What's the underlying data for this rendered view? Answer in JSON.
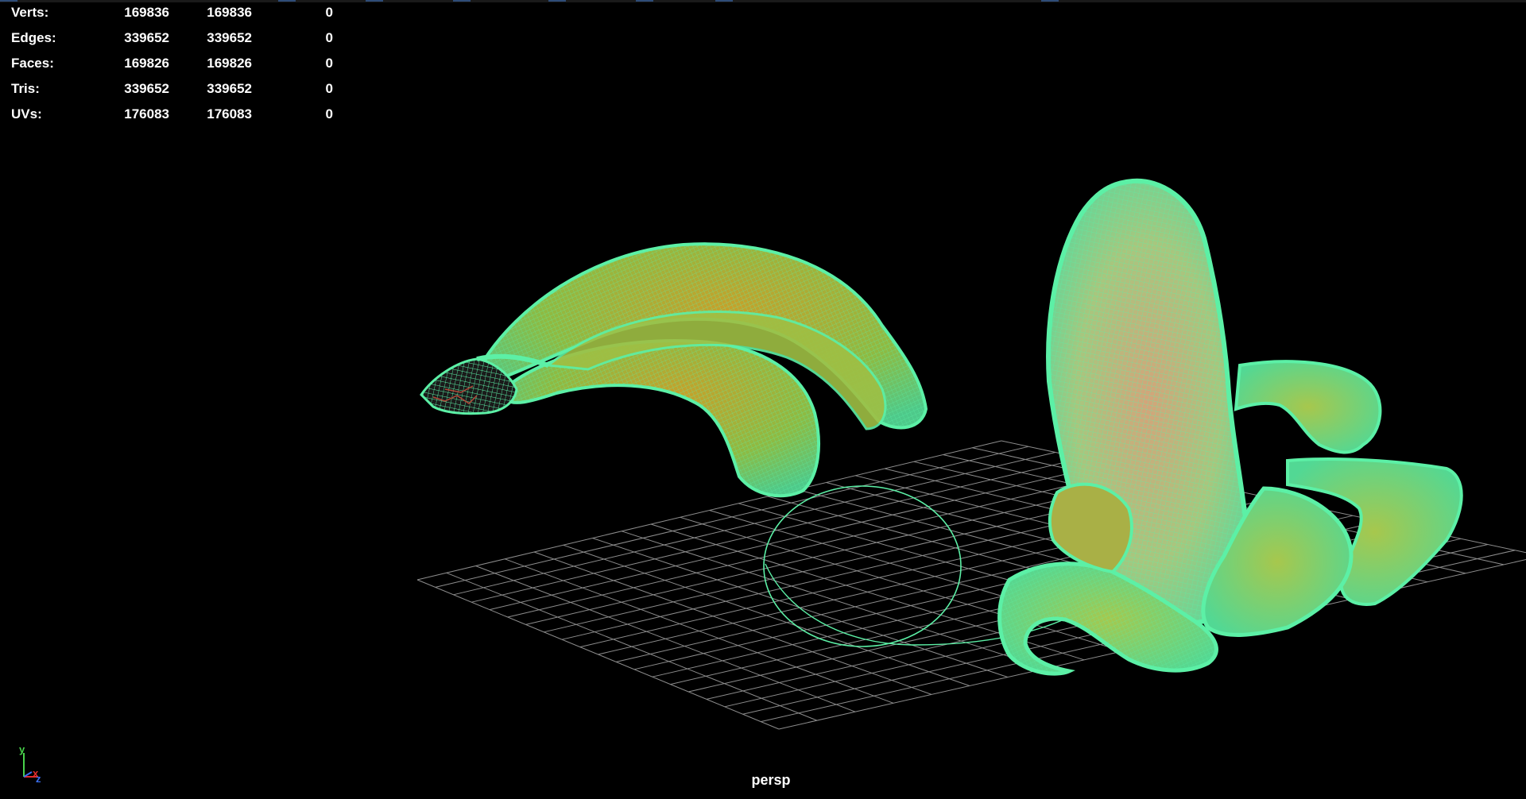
{
  "hud": {
    "rows": [
      {
        "label": "Verts:",
        "total": "169836",
        "selected": "169836",
        "extra": "0"
      },
      {
        "label": "Edges:",
        "total": "339652",
        "selected": "339652",
        "extra": "0"
      },
      {
        "label": "Faces:",
        "total": "169826",
        "selected": "169826",
        "extra": "0"
      },
      {
        "label": "Tris:",
        "total": "339652",
        "selected": "339652",
        "extra": "0"
      },
      {
        "label": "UVs:",
        "total": "176083",
        "selected": "176083",
        "extra": "0"
      }
    ]
  },
  "viewport": {
    "camera_label": "persp",
    "axis": {
      "y": "y",
      "x": "x",
      "z": "z"
    }
  },
  "colors": {
    "background": "#000000",
    "wire": "#5cf0a6",
    "wire_dark": "#2fb874",
    "fill_yellow": "#c2a825",
    "fill_orange": "#c98a2a",
    "fill_peach": "#d7b17d",
    "grid": "#8c8c8c",
    "hud_text": "#ffffff",
    "axis_y": "#49d24b",
    "axis_x": "#e22d2d",
    "axis_z": "#3b6ff0"
  },
  "icons": [
    "axis-gizmo-icon"
  ]
}
